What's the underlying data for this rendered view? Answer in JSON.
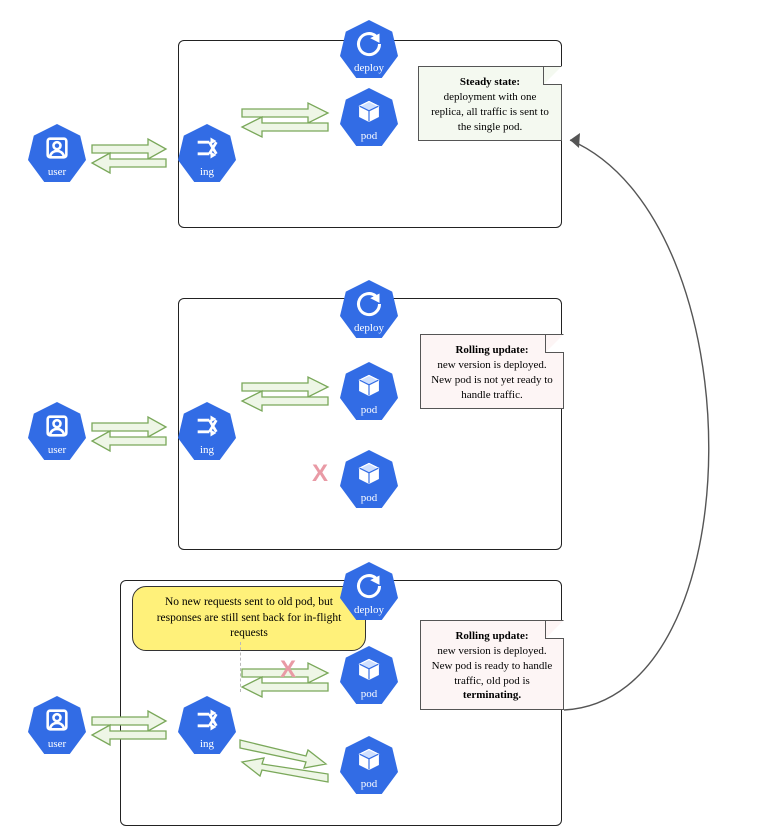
{
  "icons": {
    "user": "user",
    "ing": "ing",
    "deploy": "deploy",
    "pod": "pod"
  },
  "panels": [
    {
      "id": "steady",
      "note": {
        "title": "Steady state:",
        "body": "deployment with one replica, all traffic is sent to the single pod."
      }
    },
    {
      "id": "update1",
      "note": {
        "title": "Rolling update:",
        "body": "new version is deployed. New pod is not yet ready to handle traffic."
      }
    },
    {
      "id": "update2",
      "note": {
        "title": "Rolling update:",
        "body": "new version is deployed. New pod is ready to handle traffic, old pod is",
        "tailBold": "terminating."
      },
      "yellow": "No new requests sent to old pod, but responses are still sent back for in-flight requests"
    }
  ],
  "arrowGlyph": "bidirectional-arrow-pair"
}
